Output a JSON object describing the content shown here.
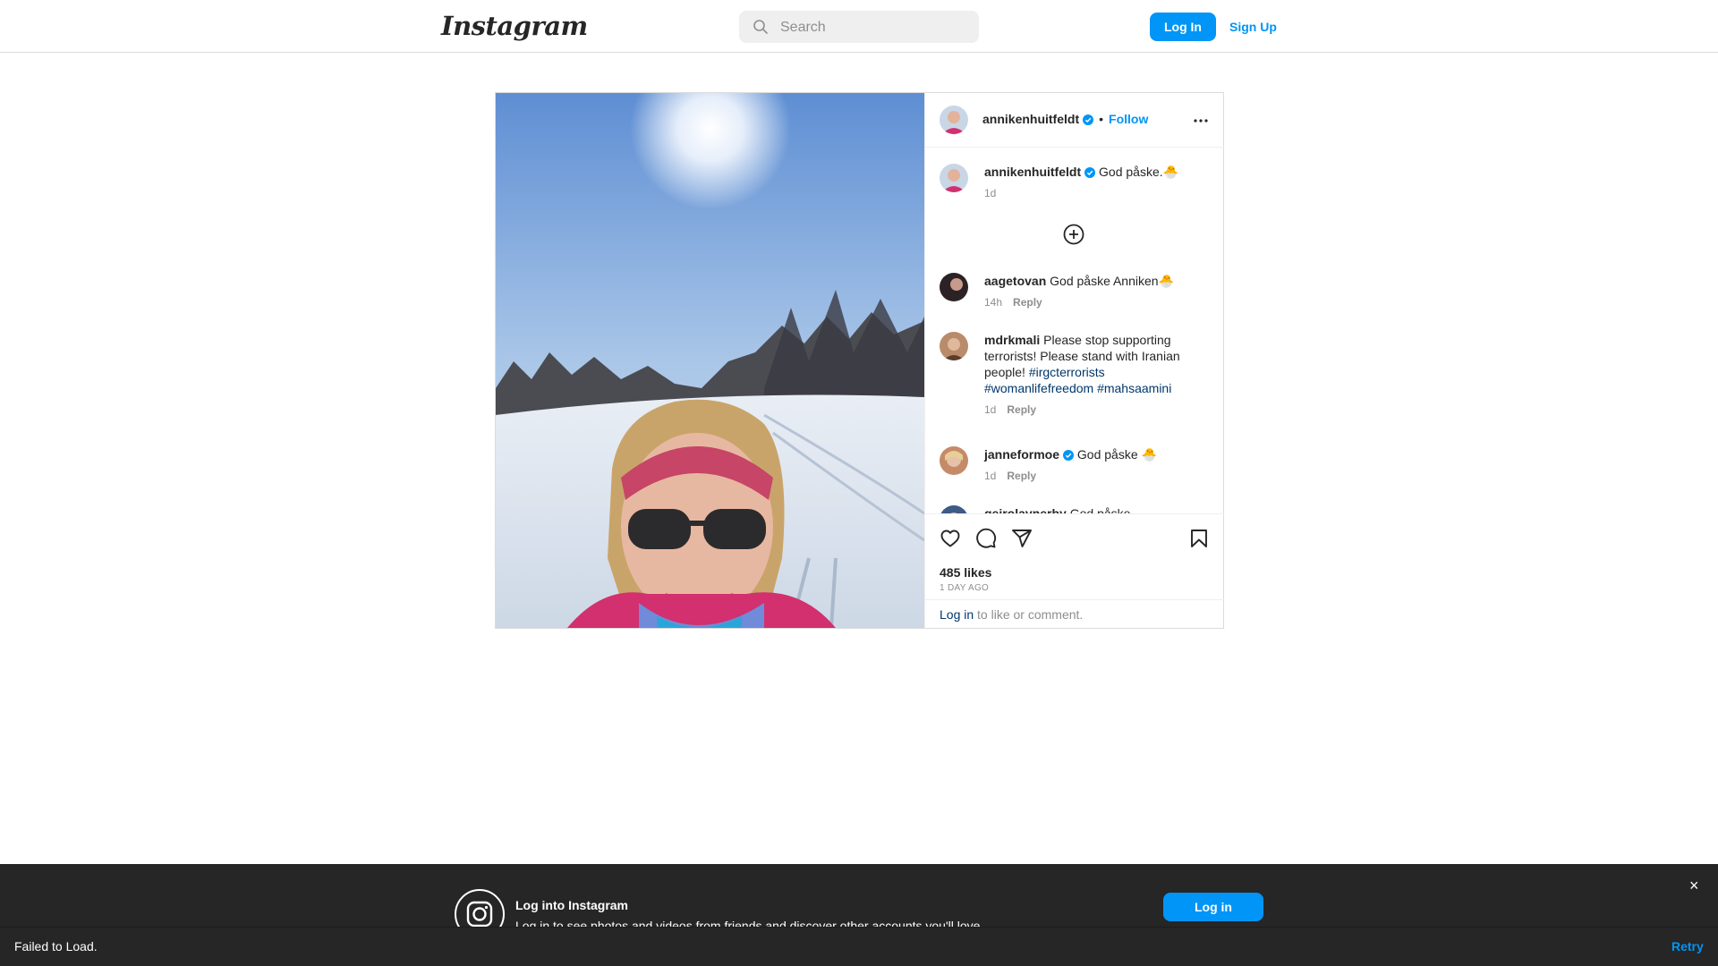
{
  "nav": {
    "logo": "Instagram",
    "search_placeholder": "Search",
    "login_label": "Log In",
    "signup_label": "Sign Up"
  },
  "post": {
    "author": "annikenhuitfeldt",
    "follow_label": "Follow",
    "separator": "•",
    "caption": "God påske.🐣",
    "caption_time": "1d",
    "likes": "485 likes",
    "posted_ago": "1 DAY AGO",
    "login_link": "Log in",
    "login_suffix": " to like or comment."
  },
  "comments": [
    {
      "user": "aagetovan",
      "text": "God påske Anniken🐣",
      "time": "14h",
      "reply": "Reply"
    },
    {
      "user": "mdrkmali",
      "text": "Please stop supporting terrorists! Please stand with Iranian people! ",
      "tags": [
        "#irgcterrorists",
        "#womanlifefreedom",
        "#mahsaamini"
      ],
      "time": "1d",
      "reply": "Reply"
    },
    {
      "user": "janneformoe",
      "text": "God påske 🐣",
      "time": "1d",
      "reply": "Reply"
    },
    {
      "user": "geirolavnerby",
      "text": "God påske",
      "time": "",
      "reply": ""
    }
  ],
  "banner": {
    "title": "Log into Instagram",
    "subtitle": "Log in to see photos and videos from friends and discover other accounts you'll love.",
    "button": "Log in",
    "close": "×"
  },
  "toast": {
    "message": "Failed to Load.",
    "retry": "Retry"
  },
  "colors": {
    "accent": "#0095f6",
    "link": "#00376b",
    "text": "#262626",
    "muted": "#8e8e8e",
    "banner_bg": "#262626"
  },
  "icons": [
    "search-icon",
    "verified-badge-icon",
    "more-options-icon",
    "add-circle-icon",
    "heart-icon",
    "comment-icon",
    "share-icon",
    "bookmark-icon",
    "instagram-glyph-icon",
    "close-icon"
  ]
}
